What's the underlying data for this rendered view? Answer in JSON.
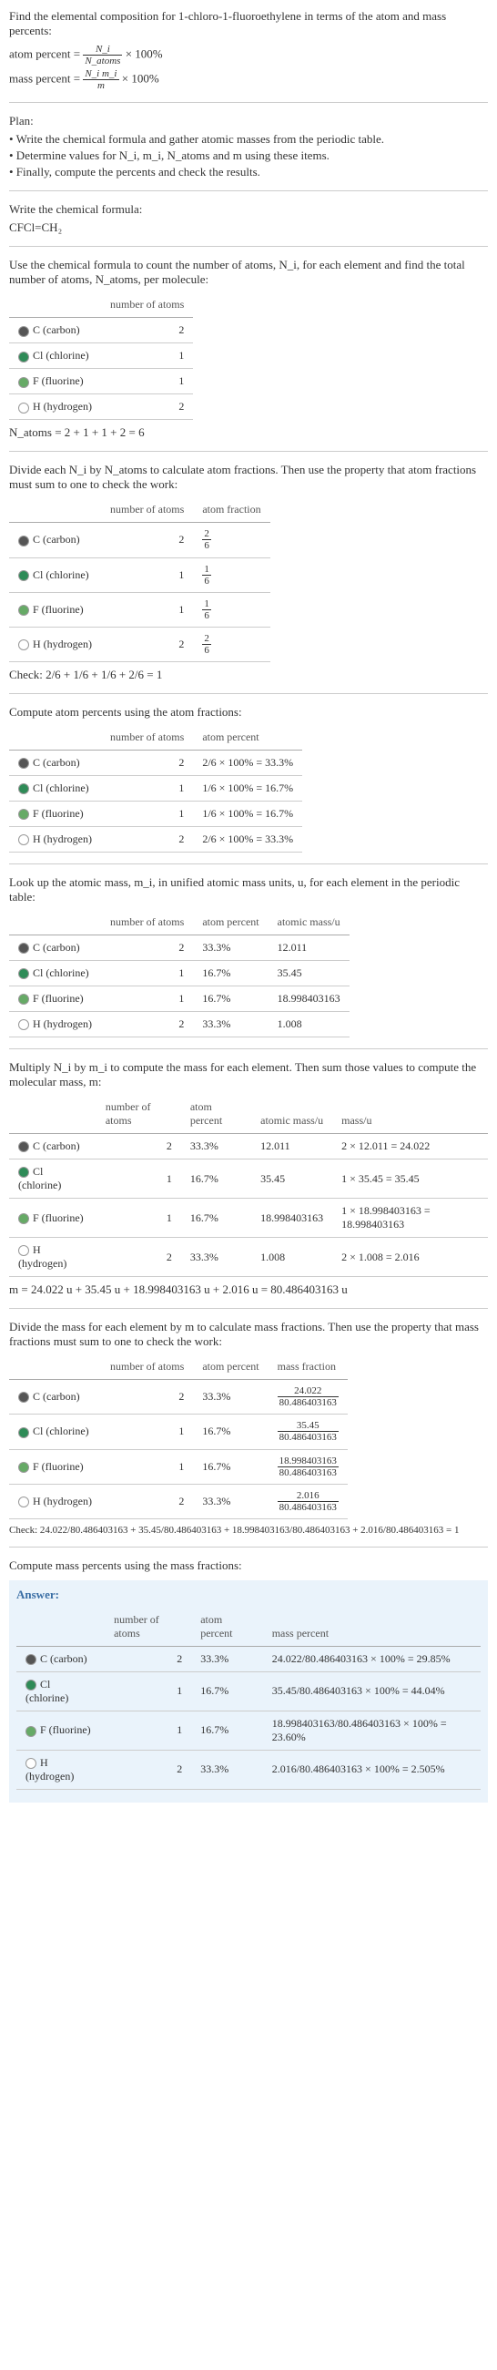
{
  "intro": "Find the elemental composition for 1-chloro-1-fluoroethylene in terms of the atom and mass percents:",
  "formula_atom": "atom percent = ",
  "formula_atom_frac_num": "N_i",
  "formula_atom_frac_den": "N_atoms",
  "formula_atom_tail": " × 100%",
  "formula_mass": "mass percent = ",
  "formula_mass_frac_num": "N_i m_i",
  "formula_mass_frac_den": "m",
  "formula_mass_tail": " × 100%",
  "plan_head": "Plan:",
  "plan1": "• Write the chemical formula and gather atomic masses from the periodic table.",
  "plan2": "• Determine values for N_i, m_i, N_atoms and m using these items.",
  "plan3": "• Finally, compute the percents and check the results.",
  "write_formula": "Write the chemical formula:",
  "chem_formula": "CFCl=CH₂",
  "count_text": "Use the chemical formula to count the number of atoms, N_i, for each element and find the total number of atoms, N_atoms, per molecule:",
  "headers": {
    "element_blank": " ",
    "n_atoms": "number of atoms",
    "atom_fraction": "atom fraction",
    "atom_percent": "atom percent",
    "atomic_mass": "atomic mass/u",
    "mass_u": "mass/u",
    "mass_fraction": "mass fraction",
    "mass_percent": "mass percent"
  },
  "elements": {
    "c": {
      "name": "C (carbon)",
      "n": "2"
    },
    "cl": {
      "name": "Cl (chlorine)",
      "n": "1"
    },
    "f": {
      "name": "F (fluorine)",
      "n": "1"
    },
    "h": {
      "name": "H (hydrogen)",
      "n": "2"
    }
  },
  "natoms_line": "N_atoms = 2 + 1 + 1 + 2 = 6",
  "divide_text": "Divide each N_i by N_atoms to calculate atom fractions. Then use the property that atom fractions must sum to one to check the work:",
  "fractions": {
    "c": {
      "num": "2",
      "den": "6"
    },
    "cl": {
      "num": "1",
      "den": "6"
    },
    "f": {
      "num": "1",
      "den": "6"
    },
    "h": {
      "num": "2",
      "den": "6"
    }
  },
  "check_fraction": "Check: 2/6 + 1/6 + 1/6 + 2/6 = 1",
  "compute_atom_pct": "Compute atom percents using the atom fractions:",
  "atom_pct": {
    "c": "2/6 × 100% = 33.3%",
    "cl": "1/6 × 100% = 16.7%",
    "f": "1/6 × 100% = 16.7%",
    "h": "2/6 × 100% = 33.3%"
  },
  "lookup_text": "Look up the atomic mass, m_i, in unified atomic mass units, u, for each element in the periodic table:",
  "atom_pct_short": {
    "c": "33.3%",
    "cl": "16.7%",
    "f": "16.7%",
    "h": "33.3%"
  },
  "atomic_mass": {
    "c": "12.011",
    "cl": "35.45",
    "f": "18.998403163",
    "h": "1.008"
  },
  "multiply_text": "Multiply N_i by m_i to compute the mass for each element. Then sum those values to compute the molecular mass, m:",
  "mass_calc": {
    "c": "2 × 12.011 = 24.022",
    "cl": "1 × 35.45 = 35.45",
    "f": "1 × 18.998403163 = 18.998403163",
    "h": "2 × 1.008 = 2.016"
  },
  "m_total": "m = 24.022 u + 35.45 u + 18.998403163 u + 2.016 u = 80.486403163 u",
  "divide_mass_text": "Divide the mass for each element by m to calculate mass fractions. Then use the property that mass fractions must sum to one to check the work:",
  "mass_frac": {
    "c_num": "24.022",
    "c_den": "80.486403163",
    "cl_num": "35.45",
    "cl_den": "80.486403163",
    "f_num": "18.998403163",
    "f_den": "80.486403163",
    "h_num": "2.016",
    "h_den": "80.486403163"
  },
  "check_mass": "Check: 24.022/80.486403163 + 35.45/80.486403163 + 18.998403163/80.486403163 + 2.016/80.486403163 = 1",
  "compute_mass_pct": "Compute mass percents using the mass fractions:",
  "answer_label": "Answer:",
  "mass_pct": {
    "c": "24.022/80.486403163 × 100% = 29.85%",
    "cl": "35.45/80.486403163 × 100% = 44.04%",
    "f": "18.998403163/80.486403163 × 100% = 23.60%",
    "h": "2.016/80.486403163 × 100% = 2.505%"
  },
  "chart_data": {
    "type": "table",
    "title": "Elemental composition of 1-chloro-1-fluoroethylene",
    "elements": [
      "C",
      "Cl",
      "F",
      "H"
    ],
    "number_of_atoms": [
      2,
      1,
      1,
      2
    ],
    "N_atoms_total": 6,
    "atom_fraction": [
      0.3333,
      0.1667,
      0.1667,
      0.3333
    ],
    "atom_percent": [
      33.3,
      16.7,
      16.7,
      33.3
    ],
    "atomic_mass_u": [
      12.011,
      35.45,
      18.998403163,
      1.008
    ],
    "element_mass_u": [
      24.022,
      35.45,
      18.998403163,
      2.016
    ],
    "molecular_mass_u": 80.486403163,
    "mass_fraction": [
      0.2985,
      0.4404,
      0.236,
      0.02505
    ],
    "mass_percent": [
      29.85,
      44.04,
      23.6,
      2.505
    ]
  }
}
